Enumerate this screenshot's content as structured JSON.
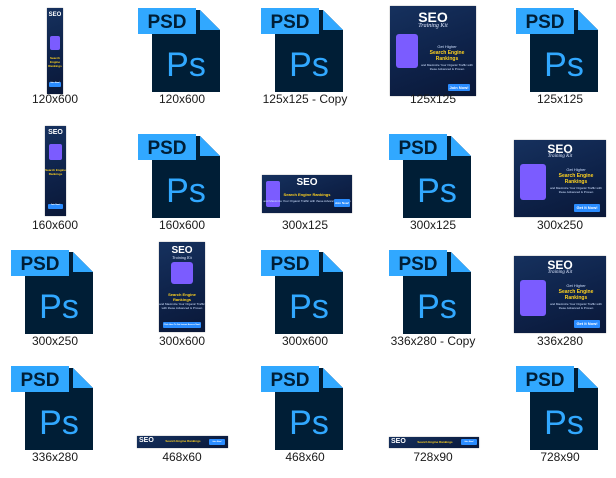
{
  "files": [
    {
      "name": "120x600",
      "type": "banner",
      "variant": "tall-narrow"
    },
    {
      "name": "120x600",
      "type": "psd"
    },
    {
      "name": "125x125 - Copy",
      "type": "psd"
    },
    {
      "name": "125x125",
      "type": "banner",
      "variant": "square"
    },
    {
      "name": "125x125",
      "type": "psd"
    },
    {
      "name": "160x600",
      "type": "banner",
      "variant": "tall"
    },
    {
      "name": "160x600",
      "type": "psd"
    },
    {
      "name": "300x125",
      "type": "banner",
      "variant": "wide"
    },
    {
      "name": "300x125",
      "type": "psd"
    },
    {
      "name": "300x250",
      "type": "banner",
      "variant": "rect"
    },
    {
      "name": "300x250",
      "type": "psd"
    },
    {
      "name": "300x600",
      "type": "banner",
      "variant": "half-page"
    },
    {
      "name": "300x600",
      "type": "psd"
    },
    {
      "name": "336x280 - Copy",
      "type": "psd"
    },
    {
      "name": "336x280",
      "type": "banner",
      "variant": "rect"
    },
    {
      "name": "336x280",
      "type": "psd"
    },
    {
      "name": "468x60",
      "type": "banner",
      "variant": "leader"
    },
    {
      "name": "468x60",
      "type": "psd"
    },
    {
      "name": "728x90",
      "type": "banner",
      "variant": "leader"
    },
    {
      "name": "728x90",
      "type": "psd"
    }
  ],
  "psd_icon": {
    "badge_text": "PSD",
    "logo_text": "Ps",
    "badge_color": "#31a8ff",
    "body_color": "#001e36",
    "accent": "#31a8ff"
  },
  "banner": {
    "brand": "SEO",
    "kit": "Training Kit",
    "get": "Get Higher",
    "headline": "Search Engine Rankings",
    "body": "and Maximize Your Organic Traffic with these Advanced & Proven",
    "body2": "SEO",
    "body3": "Techniques!",
    "cta_short": "Join Now!",
    "cta_long": "Get It Now!",
    "cta_wide": "Click Here To Get Instant Access Now!",
    "accent": "#ffd21f",
    "background": "#0e2249"
  }
}
